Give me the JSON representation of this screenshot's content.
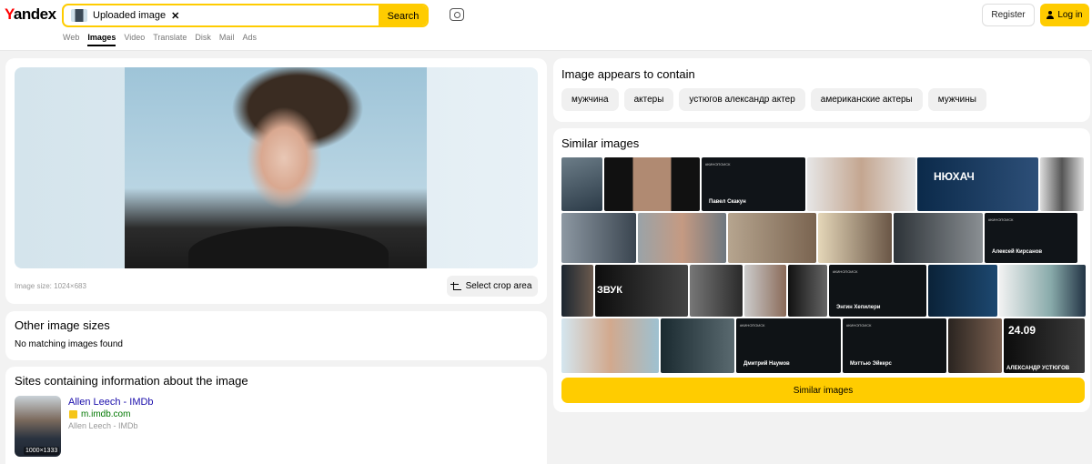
{
  "header": {
    "logo": "Yandex",
    "search_chip_label": "Uploaded image",
    "search_button": "Search",
    "nav": [
      "Web",
      "Images",
      "Video",
      "Translate",
      "Disk",
      "Mail",
      "Ads"
    ],
    "active_nav": "Images",
    "register": "Register",
    "login": "Log in"
  },
  "image_panel": {
    "size_text": "Image size: 1024×683",
    "crop_button": "Select crop area"
  },
  "other_sizes": {
    "title": "Other image sizes",
    "text": "No matching images found"
  },
  "sites": {
    "title": "Sites containing information about the image",
    "items": [
      {
        "title": "Allen Leech - IMDb",
        "url": "m.imdb.com",
        "desc": "Allen Leech - IMDb",
        "dims": "1000×1333"
      }
    ]
  },
  "contains": {
    "title": "Image appears to contain",
    "tags": [
      "мужчина",
      "актеры",
      "устюгов александр актер",
      "американские актеры",
      "мужчины"
    ]
  },
  "similar": {
    "title": "Similar images",
    "button": "Similar images",
    "captions": {
      "pavel": "Павел Скакун",
      "aleksei": "Алексей Кирсанов",
      "engin": "Энгин Хепилери",
      "dmitry": "Дмитрий Наумов",
      "matthew": "Мэттью Эйкерс",
      "ustyugov": "АЛЕКСАНДР УСТЮГОВ",
      "date": "24.09",
      "nyukhach": "НЮХАЧ",
      "zvuk": "ЗВУК",
      "kinopoisk": "#КИНОПОИСК"
    }
  },
  "colors": {
    "accent": "#ffcc00",
    "link": "#1a0dab",
    "url": "#007700"
  }
}
